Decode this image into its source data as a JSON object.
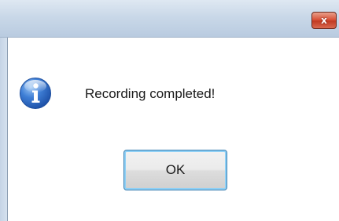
{
  "window": {
    "title": "",
    "close_label": "x"
  },
  "dialog": {
    "icon": "information-icon",
    "message": "Recording completed!",
    "ok_label": "OK"
  },
  "colors": {
    "titlebar": "#c9d8e8",
    "close_button": "#d9543a",
    "button_focus": "#3c7fb1"
  }
}
